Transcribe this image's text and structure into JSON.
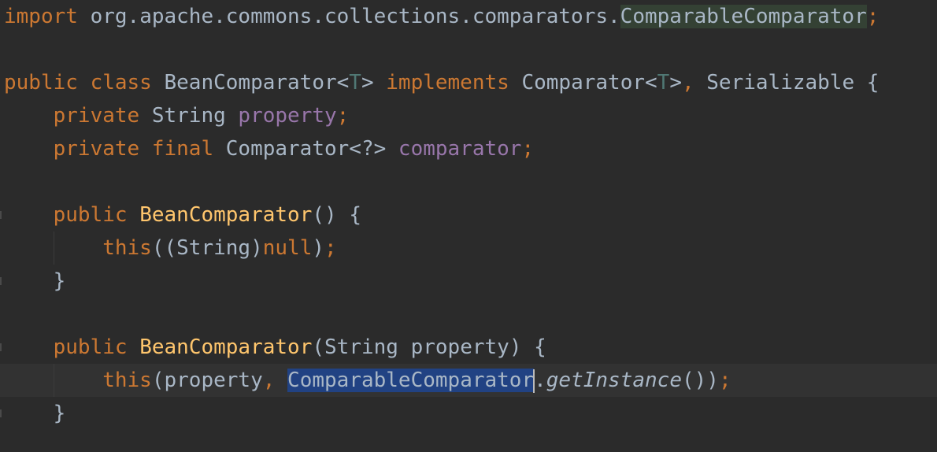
{
  "editor": {
    "colors": {
      "background": "#2b2b2b",
      "current_line": "#323232",
      "keyword": "#cc7832",
      "identifier": "#a9b7c6",
      "field": "#9876aa",
      "type_parameter": "#507874",
      "method_declaration": "#ffc66d",
      "usage_highlight": "#344134",
      "selection": "#214283"
    },
    "lines": [
      {
        "tokens": [
          {
            "text": "import",
            "kind": "kw"
          },
          {
            "text": " org.apache.commons.collections.comparators.",
            "kind": "plain"
          },
          {
            "text": "ComparableComparator",
            "kind": "plain",
            "hl": "usage"
          },
          {
            "text": ";",
            "kind": "kw"
          }
        ]
      },
      {
        "tokens": []
      },
      {
        "tokens": [
          {
            "text": "public class",
            "kind": "kw"
          },
          {
            "text": " BeanComparator<",
            "kind": "plain"
          },
          {
            "text": "T",
            "kind": "tparam"
          },
          {
            "text": "> ",
            "kind": "plain"
          },
          {
            "text": "implements",
            "kind": "kw"
          },
          {
            "text": " Comparator<",
            "kind": "plain"
          },
          {
            "text": "T",
            "kind": "tparam"
          },
          {
            "text": ">",
            "kind": "plain"
          },
          {
            "text": ",",
            "kind": "kw"
          },
          {
            "text": " Serializable {",
            "kind": "plain"
          }
        ]
      },
      {
        "tokens": [
          {
            "text": "    private",
            "kind": "kw"
          },
          {
            "text": " String ",
            "kind": "plain"
          },
          {
            "text": "property",
            "kind": "field"
          },
          {
            "text": ";",
            "kind": "kw"
          }
        ]
      },
      {
        "tokens": [
          {
            "text": "    private final",
            "kind": "kw"
          },
          {
            "text": " Comparator<?> ",
            "kind": "plain"
          },
          {
            "text": "comparator",
            "kind": "field"
          },
          {
            "text": ";",
            "kind": "kw"
          }
        ]
      },
      {
        "tokens": []
      },
      {
        "tokens": [
          {
            "text": "    public",
            "kind": "kw"
          },
          {
            "text": " ",
            "kind": "plain"
          },
          {
            "text": "BeanComparator",
            "kind": "method"
          },
          {
            "text": "() {",
            "kind": "plain"
          }
        ]
      },
      {
        "tokens": [
          {
            "text": "        this",
            "kind": "kw"
          },
          {
            "text": "((String)",
            "kind": "plain"
          },
          {
            "text": "null",
            "kind": "kw"
          },
          {
            "text": ")",
            "kind": "plain"
          },
          {
            "text": ";",
            "kind": "kw"
          }
        ]
      },
      {
        "tokens": [
          {
            "text": "    }",
            "kind": "plain"
          }
        ]
      },
      {
        "tokens": []
      },
      {
        "tokens": [
          {
            "text": "    public",
            "kind": "kw"
          },
          {
            "text": " ",
            "kind": "plain"
          },
          {
            "text": "BeanComparator",
            "kind": "method"
          },
          {
            "text": "(String property) {",
            "kind": "plain"
          }
        ]
      },
      {
        "current": true,
        "tokens": [
          {
            "text": "        this",
            "kind": "kw"
          },
          {
            "text": "(property",
            "kind": "plain"
          },
          {
            "text": ", ",
            "kind": "kw"
          },
          {
            "text": "ComparableComparato",
            "kind": "plain",
            "hl": "select"
          },
          {
            "text": "r",
            "kind": "plain",
            "hl": "select",
            "caret": true
          },
          {
            "text": ".",
            "kind": "plain"
          },
          {
            "text": "getInstance",
            "kind": "italic"
          },
          {
            "text": "())",
            "kind": "plain"
          },
          {
            "text": ";",
            "kind": "kw"
          }
        ]
      },
      {
        "tokens": [
          {
            "text": "    }",
            "kind": "plain"
          }
        ]
      }
    ]
  }
}
